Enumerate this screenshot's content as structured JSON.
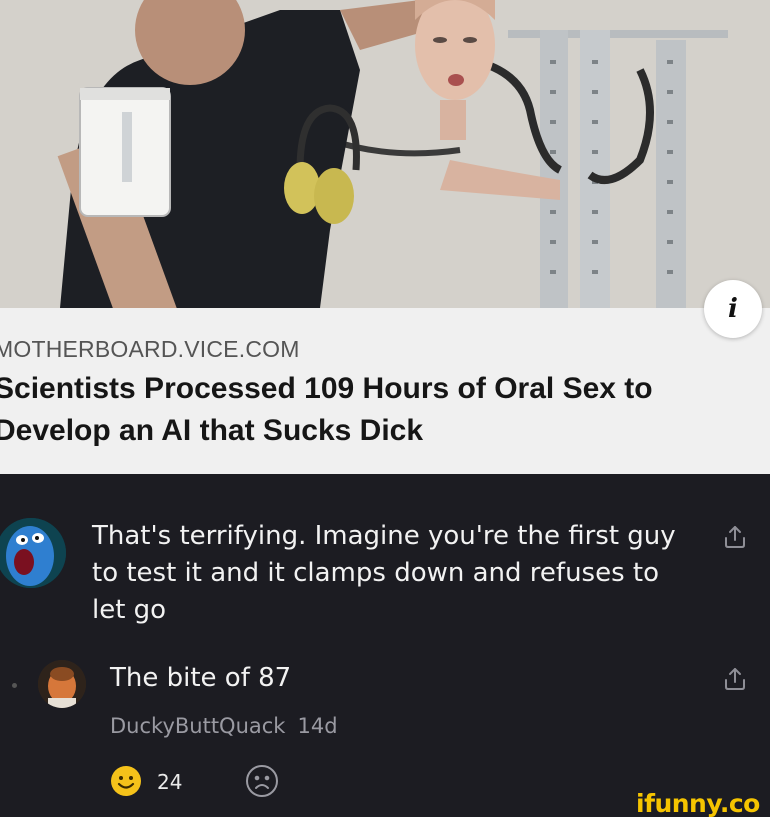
{
  "card": {
    "source": "MOTHERBOARD.VICE.COM",
    "headline": "Scientists Processed 109 Hours of Oral Sex to Develop an AI that Sucks Dick",
    "info_icon": "info-icon"
  },
  "comment": {
    "text": "That's terrifying. Imagine you're the first guy to test it and it clamps down and refuses to let go",
    "share_icon": "share-icon"
  },
  "reply": {
    "text": "The bite of 87",
    "username": "DuckyButtQuack",
    "time": "14d",
    "smile_count": "24",
    "smile_icon": "smile-icon",
    "frown_icon": "frown-icon",
    "share_icon": "share-icon"
  },
  "watermark": "ifunny.co"
}
